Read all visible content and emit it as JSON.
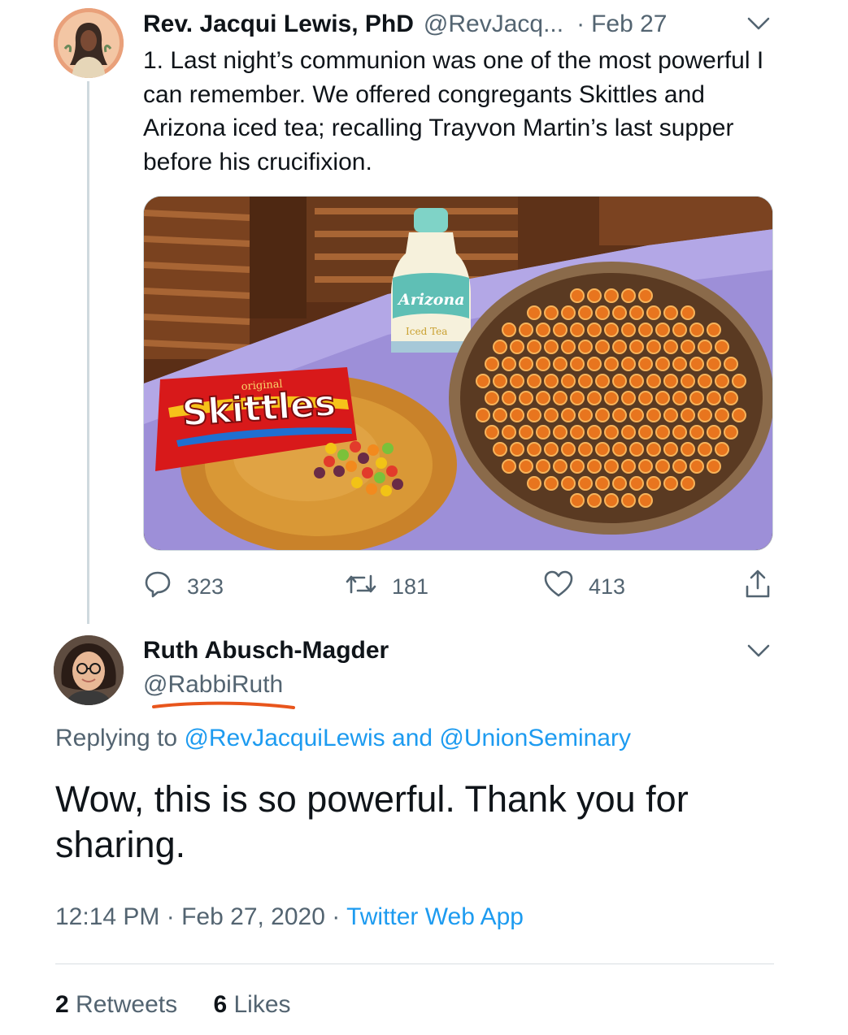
{
  "tweet": {
    "author_name": "Rev. Jacqui Lewis, PhD",
    "author_handle": "@RevJacq...",
    "separator": "·",
    "date": "Feb 27",
    "text": "1. Last night’s communion was one of the most powerful I can remember. We offered congregants Skittles and Arizona iced tea; recalling Trayvon Martin’s last supper before his crucifixion.",
    "media": {
      "brand_skittles": "Skittles",
      "brand_skittles_small": "original",
      "brand_arizona": "Arizona",
      "brand_arizona_sub": "Iced Tea"
    },
    "actions": {
      "reply_count": "323",
      "retweet_count": "181",
      "like_count": "413"
    }
  },
  "reply": {
    "author_name": "Ruth Abusch-Magder",
    "author_handle": "@RabbiRuth",
    "replying_prefix": "Replying to",
    "replying_user1": "@RevJacquiLewis",
    "replying_and": "and",
    "replying_user2": "@UnionSeminary",
    "text": "Wow, this is so powerful. Thank you for sharing.",
    "time": "12:14 PM",
    "meta_sep": "·",
    "full_date": "Feb 27, 2020",
    "source": "Twitter Web App",
    "retweets_count": "2",
    "retweets_label": "Retweets",
    "likes_count": "6",
    "likes_label": "Likes"
  },
  "colors": {
    "accent": "#1d9bf0",
    "secondary_text": "#536471",
    "primary_text": "#0f1419",
    "highlight_underline": "#e8551c"
  },
  "icons": [
    "chevron-down-icon",
    "reply-icon",
    "retweet-icon",
    "like-icon",
    "share-icon"
  ]
}
